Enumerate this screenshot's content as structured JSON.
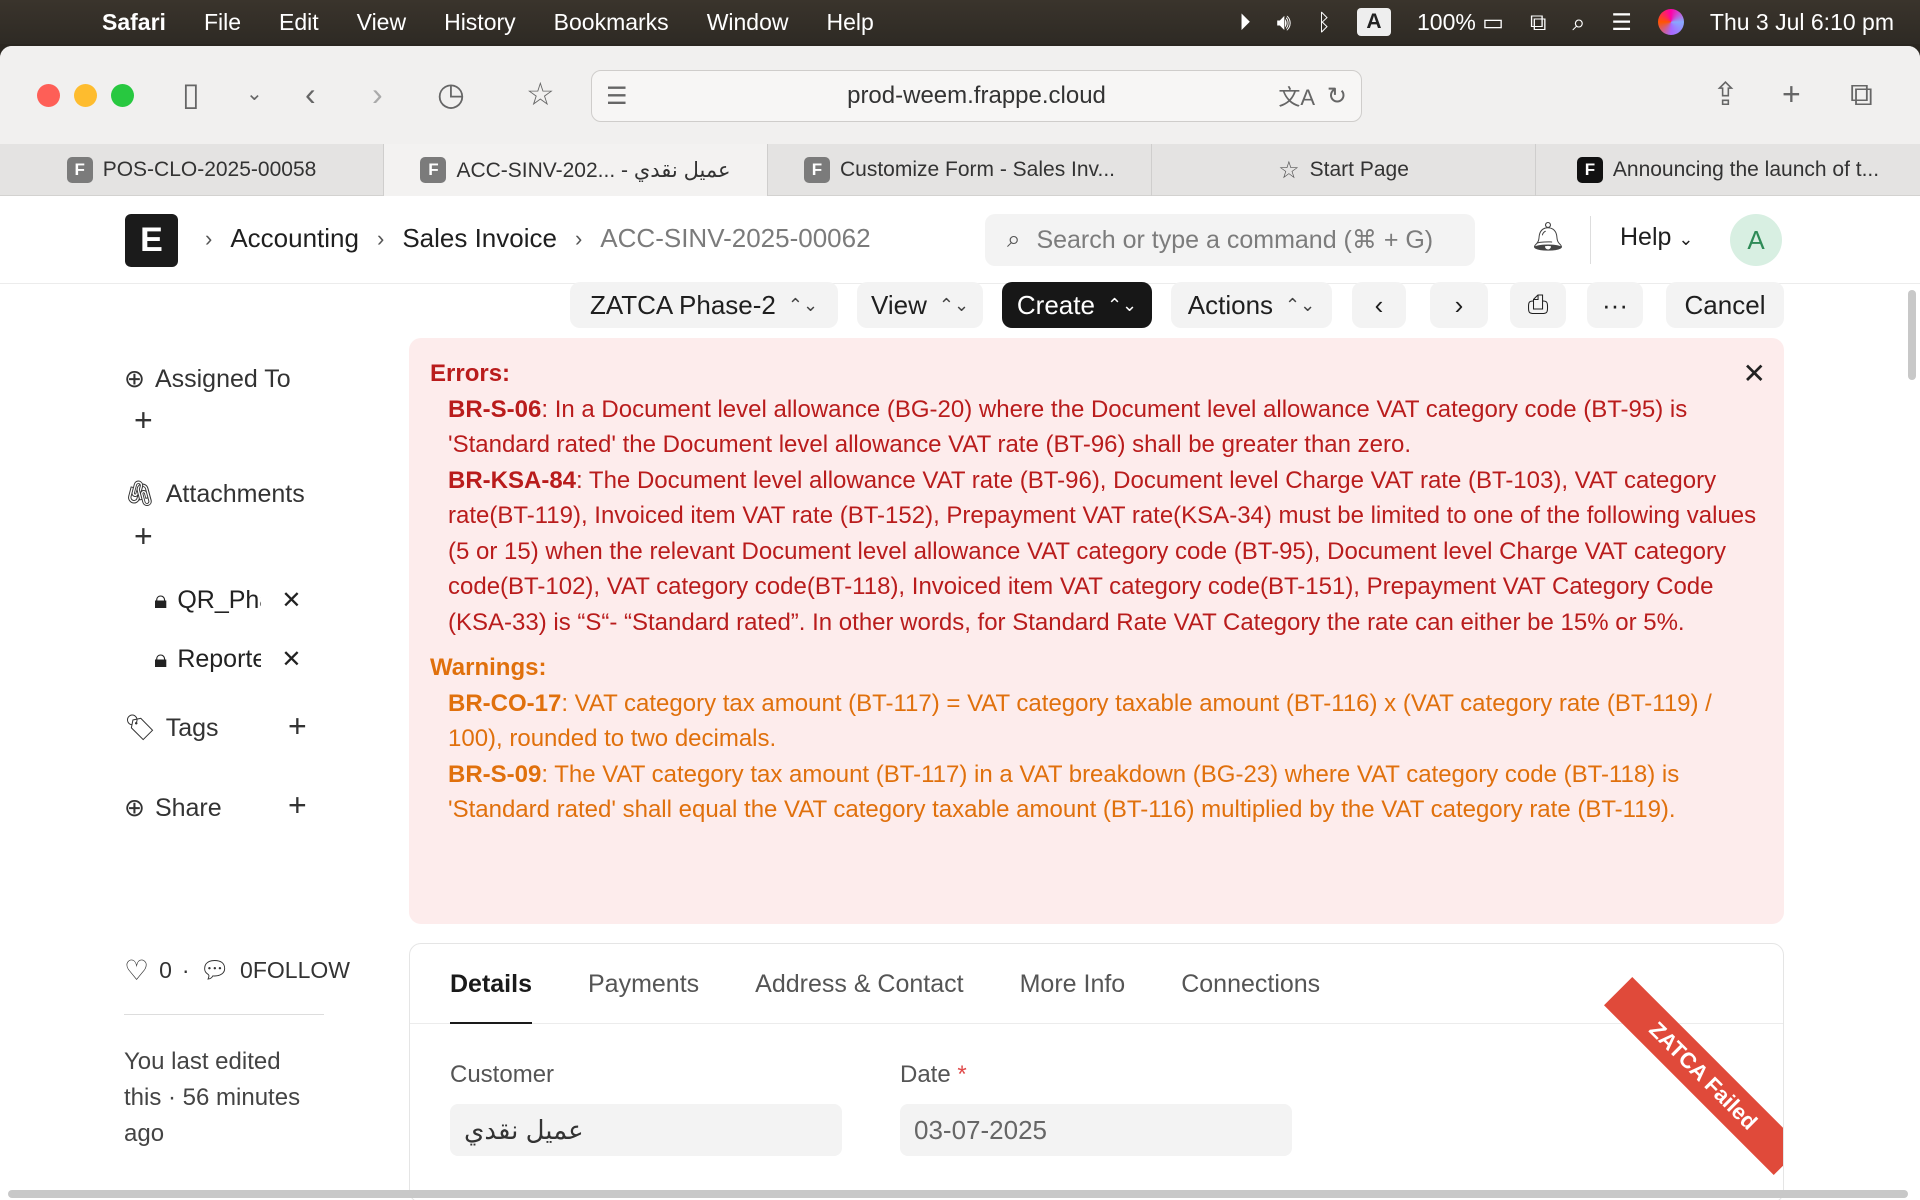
{
  "menubar": {
    "app": "Safari",
    "items": [
      "File",
      "Edit",
      "View",
      "History",
      "Bookmarks",
      "Window",
      "Help"
    ],
    "keyboard": "A",
    "battery": "100%",
    "datetime": "Thu 3 Jul  6:10 pm"
  },
  "browser": {
    "url": "prod-weem.frappe.cloud",
    "tabs": [
      {
        "label": "POS-CLO-2025-00058",
        "favicon": "F"
      },
      {
        "label": "ACC-SINV-202... - عميل نقدي",
        "favicon": "F"
      },
      {
        "label": "Customize Form - Sales Inv...",
        "favicon": "F"
      },
      {
        "label": "Start Page",
        "favicon": "star-icon"
      },
      {
        "label": "Announcing the launch of t...",
        "favicon": "F"
      }
    ]
  },
  "nav": {
    "breadcrumbs": [
      "Accounting",
      "Sales Invoice",
      "ACC-SINV-2025-00062"
    ],
    "search_placeholder": "Search or type a command (⌘ + G)",
    "help": "Help",
    "avatar": "A"
  },
  "actions": {
    "zatca": "ZATCA Phase-2",
    "view": "View",
    "create": "Create",
    "actions": "Actions",
    "cancel": "Cancel"
  },
  "sidebar": {
    "assigned_to": "Assigned To",
    "attachments": "Attachments",
    "attachment_files": [
      "QR_Phase",
      "Reported"
    ],
    "tags": "Tags",
    "share": "Share",
    "likes": "0",
    "comments": "0",
    "follow": "FOLLOW",
    "last_edited": "You last edited this · 56 minutes ago"
  },
  "messages": {
    "errors_title": "Errors:",
    "errors": [
      {
        "code": "BR-S-06",
        "text": ": In a Document level allowance (BG-20) where the Document level allowance VAT category code (BT-95) is 'Standard rated' the Document level allowance VAT rate (BT-96) shall be greater than zero."
      },
      {
        "code": "BR-KSA-84",
        "text": ": The Document level allowance VAT rate (BT-96), Document level Charge VAT rate (BT-103), VAT category rate(BT-119), Invoiced item VAT rate (BT-152), Prepayment VAT rate(KSA-34) must be limited to one of the following values (5 or 15) when the relevant Document level allowance VAT category code (BT-95), Document level Charge VAT category code(BT-102), VAT category code(BT-118), Invoiced item VAT category code(BT-151), Prepayment VAT Category Code (KSA-33) is “S“- “Standard rated”. In other words, for Standard Rate VAT Category the rate can either be 15% or 5%."
      }
    ],
    "warnings_title": "Warnings:",
    "warnings": [
      {
        "code": "BR-CO-17",
        "text": ": VAT category tax amount (BT-117) = VAT category taxable amount (BT-116) x (VAT category rate (BT-119) / 100), rounded to two decimals."
      },
      {
        "code": "BR-S-09",
        "text": ": The VAT category tax amount (BT-117) in a VAT breakdown (BG-23) where VAT category code (BT-118) is 'Standard rated' shall equal the VAT category taxable amount (BT-116) multiplied by the VAT category rate (BT-119)."
      }
    ]
  },
  "form": {
    "tabs": [
      "Details",
      "Payments",
      "Address & Contact",
      "More Info",
      "Connections"
    ],
    "customer_label": "Customer",
    "customer_value": "عميل نقدي",
    "date_label": "Date",
    "date_value": "03-07-2025",
    "ribbon": "ZATCA Failed"
  }
}
